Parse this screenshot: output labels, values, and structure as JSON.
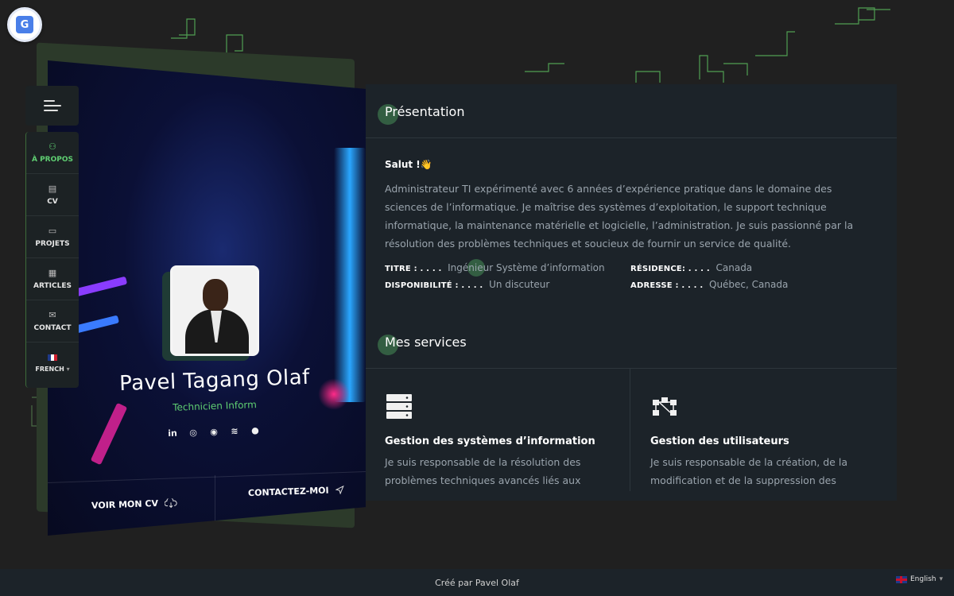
{
  "translate_badge": {
    "icon": "translate-icon",
    "glyph": "G"
  },
  "profile": {
    "name": "Pavel Tagang Olaf",
    "role": "Technicien Inform",
    "socials": [
      {
        "icon": "linkedin-icon",
        "glyph": "in"
      },
      {
        "icon": "instagram-icon",
        "glyph": "◎"
      },
      {
        "icon": "reddit-icon",
        "glyph": "◉"
      },
      {
        "icon": "stackoverflow-icon",
        "glyph": "≋"
      },
      {
        "icon": "github-icon",
        "glyph": "●"
      }
    ],
    "cv_button": "VOIR MON CV",
    "contact_button": "CONTACTEZ-MOI"
  },
  "nav": {
    "items": [
      {
        "label": "À PROPOS",
        "icon": "user-icon",
        "glyph": "⚇",
        "active": true
      },
      {
        "label": "CV",
        "icon": "document-icon",
        "glyph": "▤"
      },
      {
        "label": "PROJETS",
        "icon": "folder-icon",
        "glyph": "▭"
      },
      {
        "label": "ARTICLES",
        "icon": "newspaper-icon",
        "glyph": "▦"
      },
      {
        "label": "CONTACT",
        "icon": "mail-icon",
        "glyph": "✉"
      }
    ],
    "language": "FRENCH"
  },
  "about": {
    "title": "Présentation",
    "greeting": "Salut !👋",
    "text": "Administrateur TI expérimenté avec 6 années d’expérience pratique dans le domaine des sciences de l’informatique. Je maîtrise des systèmes d’exploitation, le support technique informatique, la maintenance matérielle et logicielle, l’administration. Je suis passionné par la résolution des problèmes techniques et soucieux de fournir un service de qualité.",
    "info": {
      "titre_label": "TITRE : . . . .",
      "titre_value": "Ingénieur Système d’information",
      "disponibilite_label": "DISPONIBILITÉ : . . . .",
      "disponibilite_value": "Un discuteur",
      "residence_label": "RÉSIDENCE: . . . .",
      "residence_value": "Canada",
      "adresse_label": "ADRESSE : . . . .",
      "adresse_value": "Québec, Canada"
    }
  },
  "services": {
    "title": "Mes services",
    "items": [
      {
        "icon": "server-icon",
        "title": "Gestion des systèmes d’information",
        "desc": "Je suis responsable de la résolution des problèmes techniques avancés liés aux"
      },
      {
        "icon": "users-network-icon",
        "title": "Gestion des utilisateurs",
        "desc": "Je suis responsable de la création, de la modification et de la suppression des"
      }
    ]
  },
  "footer": {
    "credit": "Créé par Pavel Olaf",
    "language": "English"
  },
  "colors": {
    "accent": "#5fcf72",
    "panel": "#1c2329",
    "background": "#202020"
  }
}
